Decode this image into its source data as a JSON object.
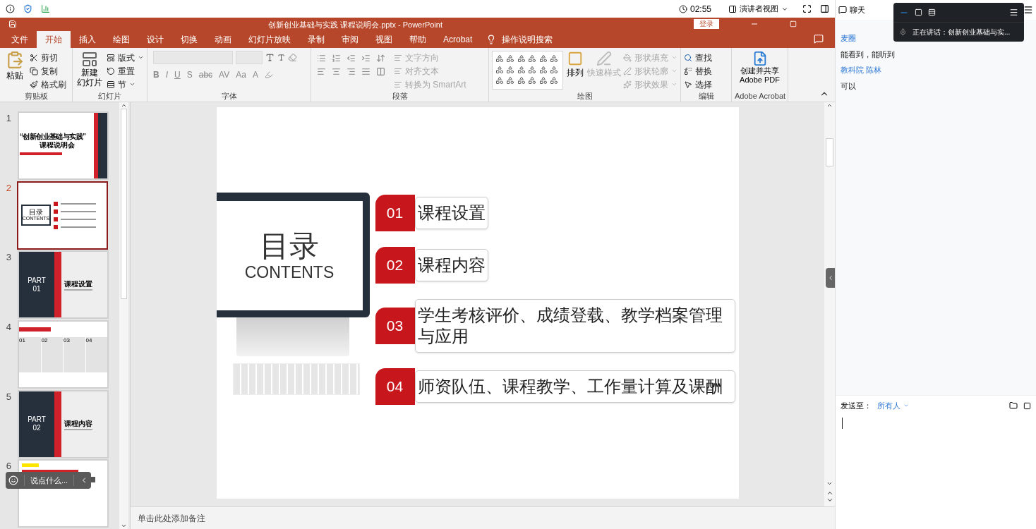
{
  "top_bar": {
    "time": "02:55",
    "view_button": "演讲者视图"
  },
  "window": {
    "title": "创新创业基础与实践 课程说明会.pptx  -  PowerPoint",
    "signin": "登录"
  },
  "tabs": [
    {
      "label": "文件",
      "selected": false
    },
    {
      "label": "开始",
      "selected": true
    },
    {
      "label": "插入",
      "selected": false
    },
    {
      "label": "绘图",
      "selected": false
    },
    {
      "label": "设计",
      "selected": false
    },
    {
      "label": "切换",
      "selected": false
    },
    {
      "label": "动画",
      "selected": false
    },
    {
      "label": "幻灯片放映",
      "selected": false
    },
    {
      "label": "录制",
      "selected": false
    },
    {
      "label": "审阅",
      "selected": false
    },
    {
      "label": "视图",
      "selected": false
    },
    {
      "label": "帮助",
      "selected": false
    },
    {
      "label": "Acrobat",
      "selected": false
    }
  ],
  "tell_me": "操作说明搜索",
  "ribbon": {
    "clipboard": {
      "label": "剪贴板",
      "paste": "粘贴",
      "items": [
        {
          "label": "剪切",
          "disabled": false
        },
        {
          "label": "复制",
          "disabled": false
        },
        {
          "label": "格式刷",
          "disabled": false
        }
      ]
    },
    "slides": {
      "label": "幻灯片",
      "new_slide": [
        "新建",
        "幻灯片"
      ],
      "items": [
        {
          "label": "版式",
          "disabled": false
        },
        {
          "label": "重置",
          "disabled": false
        },
        {
          "label": "节",
          "disabled": false
        }
      ]
    },
    "font": {
      "label": "字体",
      "buttons": [
        "B",
        "I",
        "U",
        "S",
        "abc",
        "AV",
        "Aa",
        "A"
      ]
    },
    "paragraph": {
      "label": "段落",
      "items": [
        {
          "label": "文字方向",
          "disabled": true
        },
        {
          "label": "对齐文本",
          "disabled": true
        },
        {
          "label": "转换为 SmartArt",
          "disabled": true
        }
      ]
    },
    "drawing": {
      "label": "绘图",
      "arrange": "排列",
      "quick_styles": {
        "label": "快速样式",
        "disabled": true
      },
      "items": [
        {
          "label": "形状填充",
          "disabled": true
        },
        {
          "label": "形状轮廓",
          "disabled": true
        },
        {
          "label": "形状效果",
          "disabled": true
        }
      ]
    },
    "editing": {
      "label": "编辑",
      "items": [
        {
          "label": "查找",
          "disabled": false
        },
        {
          "label": "替换",
          "disabled": false
        },
        {
          "label": "选择",
          "disabled": false
        }
      ]
    },
    "acrobat": {
      "label": "Adobe Acrobat",
      "button": [
        "创建并共享",
        "Adobe PDF"
      ]
    }
  },
  "thumbnails": [
    {
      "number": "1",
      "selected": false,
      "kind": "cover",
      "texts": [
        "“创新创业基础与实践”",
        "课程说明会"
      ]
    },
    {
      "number": "2",
      "selected": true,
      "kind": "contents",
      "texts": [
        "目录",
        "CONTENTS"
      ]
    },
    {
      "number": "3",
      "selected": false,
      "kind": "part",
      "texts": [
        "PART",
        "01",
        "课程设置"
      ]
    },
    {
      "number": "4",
      "selected": false,
      "kind": "table",
      "texts": [
        "01",
        "02",
        "03",
        "04"
      ]
    },
    {
      "number": "5",
      "selected": false,
      "kind": "part",
      "texts": [
        "PART",
        "02",
        "课程内容"
      ]
    },
    {
      "number": "6",
      "selected": false,
      "kind": "list"
    }
  ],
  "comment_box": {
    "placeholder": "说点什么..."
  },
  "slide": {
    "title": "目录",
    "subtitle": "CONTENTS",
    "items": [
      {
        "number": "01",
        "text": "课程设置"
      },
      {
        "number": "02",
        "text": "课程内容"
      },
      {
        "number": "03",
        "text": "学生考核评价、成绩登载、教学档案管理与应用"
      },
      {
        "number": "04",
        "text": "师资队伍、课程教学、工作量计算及课酬"
      }
    ]
  },
  "notes": {
    "placeholder": "单击此处添加备注"
  },
  "chat": {
    "title": "聊天",
    "speaking": "正在讲话：创新创业基础与实...",
    "messages": [
      {
        "sender": "麦圈",
        "text": "能看到，能听到"
      },
      {
        "sender": "教科院 陈林",
        "text": "可以"
      }
    ],
    "send_to_label": "发送至：",
    "send_to": "所有人"
  }
}
